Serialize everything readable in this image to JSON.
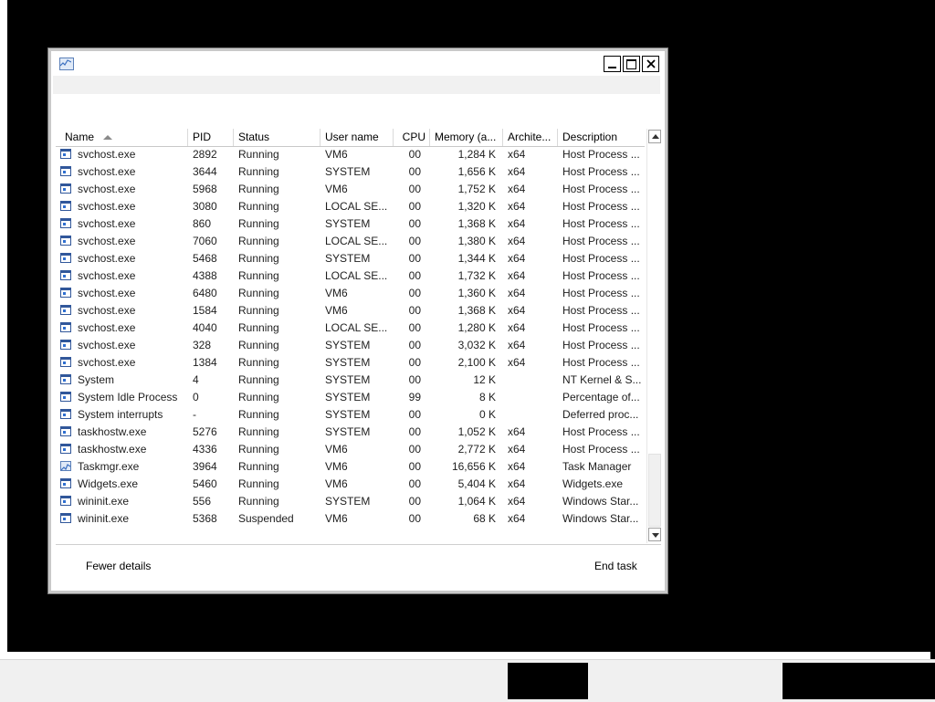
{
  "window": {
    "title": ""
  },
  "columns": {
    "name": "Name",
    "pid": "PID",
    "status": "Status",
    "user": "User name",
    "cpu": "CPU",
    "memory": "Memory (a...",
    "arch": "Archite...",
    "description": "Description"
  },
  "processes": [
    {
      "name": "svchost.exe",
      "pid": "2892",
      "status": "Running",
      "user": "VM6",
      "cpu": "00",
      "memory": "1,284 K",
      "arch": "x64",
      "description": "Host Process ...",
      "icon": "service-icon"
    },
    {
      "name": "svchost.exe",
      "pid": "3644",
      "status": "Running",
      "user": "SYSTEM",
      "cpu": "00",
      "memory": "1,656 K",
      "arch": "x64",
      "description": "Host Process ...",
      "icon": "service-icon"
    },
    {
      "name": "svchost.exe",
      "pid": "5968",
      "status": "Running",
      "user": "VM6",
      "cpu": "00",
      "memory": "1,752 K",
      "arch": "x64",
      "description": "Host Process ...",
      "icon": "service-icon"
    },
    {
      "name": "svchost.exe",
      "pid": "3080",
      "status": "Running",
      "user": "LOCAL SE...",
      "cpu": "00",
      "memory": "1,320 K",
      "arch": "x64",
      "description": "Host Process ...",
      "icon": "service-icon"
    },
    {
      "name": "svchost.exe",
      "pid": "860",
      "status": "Running",
      "user": "SYSTEM",
      "cpu": "00",
      "memory": "1,368 K",
      "arch": "x64",
      "description": "Host Process ...",
      "icon": "service-icon"
    },
    {
      "name": "svchost.exe",
      "pid": "7060",
      "status": "Running",
      "user": "LOCAL SE...",
      "cpu": "00",
      "memory": "1,380 K",
      "arch": "x64",
      "description": "Host Process ...",
      "icon": "service-icon"
    },
    {
      "name": "svchost.exe",
      "pid": "5468",
      "status": "Running",
      "user": "SYSTEM",
      "cpu": "00",
      "memory": "1,344 K",
      "arch": "x64",
      "description": "Host Process ...",
      "icon": "service-icon"
    },
    {
      "name": "svchost.exe",
      "pid": "4388",
      "status": "Running",
      "user": "LOCAL SE...",
      "cpu": "00",
      "memory": "1,732 K",
      "arch": "x64",
      "description": "Host Process ...",
      "icon": "service-icon"
    },
    {
      "name": "svchost.exe",
      "pid": "6480",
      "status": "Running",
      "user": "VM6",
      "cpu": "00",
      "memory": "1,360 K",
      "arch": "x64",
      "description": "Host Process ...",
      "icon": "service-icon"
    },
    {
      "name": "svchost.exe",
      "pid": "1584",
      "status": "Running",
      "user": "VM6",
      "cpu": "00",
      "memory": "1,368 K",
      "arch": "x64",
      "description": "Host Process ...",
      "icon": "service-icon"
    },
    {
      "name": "svchost.exe",
      "pid": "4040",
      "status": "Running",
      "user": "LOCAL SE...",
      "cpu": "00",
      "memory": "1,280 K",
      "arch": "x64",
      "description": "Host Process ...",
      "icon": "service-icon"
    },
    {
      "name": "svchost.exe",
      "pid": "328",
      "status": "Running",
      "user": "SYSTEM",
      "cpu": "00",
      "memory": "3,032 K",
      "arch": "x64",
      "description": "Host Process ...",
      "icon": "service-icon"
    },
    {
      "name": "svchost.exe",
      "pid": "1384",
      "status": "Running",
      "user": "SYSTEM",
      "cpu": "00",
      "memory": "2,100 K",
      "arch": "x64",
      "description": "Host Process ...",
      "icon": "service-icon"
    },
    {
      "name": "System",
      "pid": "4",
      "status": "Running",
      "user": "SYSTEM",
      "cpu": "00",
      "memory": "12 K",
      "arch": "",
      "description": "NT Kernel & S...",
      "icon": "system-icon"
    },
    {
      "name": "System Idle Process",
      "pid": "0",
      "status": "Running",
      "user": "SYSTEM",
      "cpu": "99",
      "memory": "8 K",
      "arch": "",
      "description": "Percentage of...",
      "icon": "system-icon"
    },
    {
      "name": "System interrupts",
      "pid": "-",
      "status": "Running",
      "user": "SYSTEM",
      "cpu": "00",
      "memory": "0 K",
      "arch": "",
      "description": "Deferred proc...",
      "icon": "system-icon"
    },
    {
      "name": "taskhostw.exe",
      "pid": "5276",
      "status": "Running",
      "user": "SYSTEM",
      "cpu": "00",
      "memory": "1,052 K",
      "arch": "x64",
      "description": "Host Process ...",
      "icon": "service-icon"
    },
    {
      "name": "taskhostw.exe",
      "pid": "4336",
      "status": "Running",
      "user": "VM6",
      "cpu": "00",
      "memory": "2,772 K",
      "arch": "x64",
      "description": "Host Process ...",
      "icon": "service-icon"
    },
    {
      "name": "Taskmgr.exe",
      "pid": "3964",
      "status": "Running",
      "user": "VM6",
      "cpu": "00",
      "memory": "16,656 K",
      "arch": "x64",
      "description": "Task Manager",
      "icon": "task-manager-icon"
    },
    {
      "name": "Widgets.exe",
      "pid": "5460",
      "status": "Running",
      "user": "VM6",
      "cpu": "00",
      "memory": "5,404 K",
      "arch": "x64",
      "description": "Widgets.exe",
      "icon": "service-icon"
    },
    {
      "name": "wininit.exe",
      "pid": "556",
      "status": "Running",
      "user": "SYSTEM",
      "cpu": "00",
      "memory": "1,064 K",
      "arch": "x64",
      "description": "Windows Star...",
      "icon": "service-icon"
    },
    {
      "name": "wininit.exe",
      "pid": "5368",
      "status": "Suspended",
      "user": "VM6",
      "cpu": "00",
      "memory": "68 K",
      "arch": "x64",
      "description": "Windows Star...",
      "icon": "service-icon"
    }
  ],
  "footer": {
    "fewer_details": "Fewer details",
    "end_task": "End task"
  },
  "colors": {
    "desktop": "#000000",
    "window_bg": "#ffffff",
    "menubar_bg": "#f1f1f1",
    "taskbar_bg": "#f0f0f0"
  }
}
